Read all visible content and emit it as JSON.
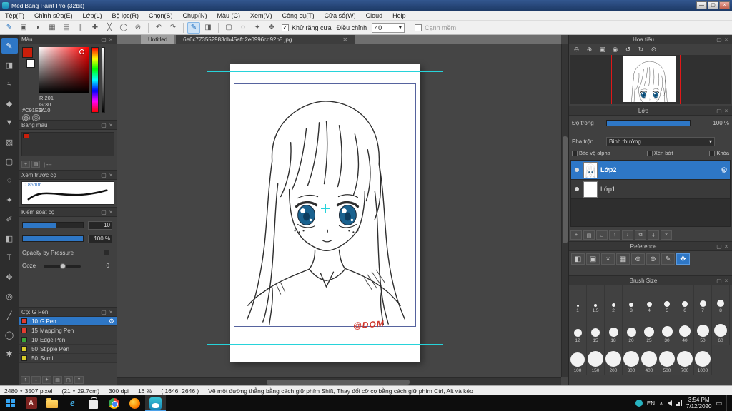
{
  "colors": {
    "accent": "#2e77c6",
    "guide_cyan": "#27d3da",
    "navigator_guide_red": "#e01818",
    "eye_blue": "#1a628f",
    "signature_red": "#cf3328",
    "foreground_swatch": "#c91e0a"
  },
  "titlebar": {
    "title": "MediBang Paint Pro (32bit)"
  },
  "window_buttons": [
    {
      "name": "minimize-button",
      "glyph": "—"
    },
    {
      "name": "maximize-button",
      "glyph": "▢"
    },
    {
      "name": "close-button",
      "glyph": "×"
    }
  ],
  "menubar": {
    "items": [
      "Tệp(F)",
      "Chỉnh sửa(E)",
      "Lớp(L)",
      "Bộ lọc(R)",
      "Chọn(S)",
      "Chụp(N)",
      "Màu (C)",
      "Xem(V)",
      "Công cụ(T)",
      "Cửa sổ(W)",
      "Cloud",
      "Help"
    ]
  },
  "toolbar": {
    "icons": [
      {
        "name": "pen-mode-icon",
        "glyph": "✎",
        "accent": true
      },
      {
        "name": "stamp-icon",
        "glyph": "▣"
      },
      {
        "name": "speech-bubble-icon",
        "glyph": "◗"
      },
      {
        "name": "grid-icon",
        "glyph": "▦"
      },
      {
        "name": "material-icon",
        "glyph": "▤"
      },
      {
        "name": "snap-parallel-icon",
        "glyph": "∥"
      },
      {
        "name": "snap-cross-icon",
        "glyph": "✚"
      },
      {
        "name": "snap-vanish-icon",
        "glyph": "╳"
      },
      {
        "name": "snap-circle-icon",
        "glyph": "◯"
      },
      {
        "name": "snap-off-icon",
        "glyph": "⊘"
      },
      {
        "sep": true
      },
      {
        "name": "undo-icon",
        "glyph": "↶"
      },
      {
        "name": "redo-icon",
        "glyph": "↷"
      },
      {
        "sep": true
      },
      {
        "name": "brush-tool-icon",
        "glyph": "✎",
        "selected": true
      },
      {
        "name": "eraser-tool-icon",
        "glyph": "◨"
      },
      {
        "sep": true
      },
      {
        "name": "select-rect-icon",
        "glyph": "▢"
      },
      {
        "name": "select-lasso-icon",
        "glyph": "◌"
      },
      {
        "name": "magic-wand-icon",
        "glyph": "✦"
      },
      {
        "name": "move-tool-icon",
        "glyph": "✥"
      }
    ],
    "antialias_label": "Khử răng cưa",
    "adjust_label": "Điều chỉnh",
    "adjust_value": "40",
    "soft_label": "Cạnh mềm"
  },
  "tabs": [
    {
      "label": "Untitled",
      "active": false
    },
    {
      "label": "6e6c773552983db45afd2e0996cd92b5.jpg",
      "active": true
    }
  ],
  "tools": [
    {
      "name": "brush-tool",
      "glyph": "✎",
      "active": true
    },
    {
      "name": "eraser-tool",
      "glyph": "◨"
    },
    {
      "name": "smudge-tool",
      "glyph": "≈"
    },
    {
      "name": "fill-tool",
      "glyph": "◆"
    },
    {
      "name": "bucket-tool",
      "glyph": "▼"
    },
    {
      "name": "gradient-tool",
      "glyph": "▨"
    },
    {
      "name": "select-tool",
      "glyph": "▢"
    },
    {
      "name": "lasso-tool",
      "glyph": "◌"
    },
    {
      "name": "magic-wand-tool",
      "glyph": "✦"
    },
    {
      "name": "select-pen-tool",
      "glyph": "✐"
    },
    {
      "name": "select-eraser-tool",
      "glyph": "◧"
    },
    {
      "name": "text-tool",
      "glyph": "T"
    },
    {
      "name": "operation-tool",
      "glyph": "✥"
    },
    {
      "name": "eyedropper-tool",
      "glyph": "◎"
    },
    {
      "name": "divide-tool",
      "glyph": "╱"
    },
    {
      "name": "zoom-tool",
      "glyph": "◯"
    },
    {
      "name": "hand-tool",
      "glyph": "✱"
    }
  ],
  "panel_buttons": {
    "dock": "▢",
    "close": "×"
  },
  "color_panel": {
    "title": "Màu",
    "r": "R:201",
    "g": "G:30",
    "b": "B:10",
    "hex": "#C91E0A",
    "icons": [
      {
        "name": "color-wheel-icon",
        "glyph": "◍"
      },
      {
        "name": "color-mode-icon",
        "glyph": "◎"
      }
    ]
  },
  "palette_panel": {
    "title": "Bảng màu",
    "name_label": "| ---",
    "icons": [
      {
        "name": "palette-add-icon",
        "glyph": "+"
      },
      {
        "name": "palette-menu-icon",
        "glyph": "▤"
      }
    ]
  },
  "preview_panel": {
    "title": "Xem trước cọ",
    "size_label": "0.85mm"
  },
  "control_panel": {
    "title": "Kiểm soát cọ",
    "size_value": "10",
    "opacity_value": "100 %",
    "pressure_label": "Opacity by Pressure",
    "ooze_label": "Ooze",
    "ooze_value": "0"
  },
  "brush_panel": {
    "title": "Cọ: G Pen",
    "brushes": [
      {
        "size": "10",
        "name": "G Pen",
        "chip": "#e23c30",
        "selected": true
      },
      {
        "size": "15",
        "name": "Mapping Pen",
        "chip": "#e23c30",
        "selected": false
      },
      {
        "size": "10",
        "name": "Edge Pen",
        "chip": "#3aa53a",
        "selected": false
      },
      {
        "size": "50",
        "name": "Stipple Pen",
        "chip": "#d9cc2a",
        "selected": false
      },
      {
        "size": "50",
        "name": "Sumi",
        "chip": "#d9cc2a",
        "selected": false
      }
    ],
    "foot_icons": [
      {
        "name": "brush-prev-icon",
        "glyph": "↑"
      },
      {
        "name": "brush-next-icon",
        "glyph": "↓"
      },
      {
        "name": "brush-add-icon",
        "glyph": "+"
      },
      {
        "name": "brush-menu-icon",
        "glyph": "▤"
      },
      {
        "name": "brush-duplicate-icon",
        "glyph": "▢"
      },
      {
        "name": "brush-delete-icon",
        "glyph": "×"
      }
    ]
  },
  "navigator": {
    "title": "Hoa tiêu",
    "icons": [
      {
        "name": "zoom-out-icon",
        "glyph": "⊖"
      },
      {
        "name": "zoom-in-icon",
        "glyph": "⊕"
      },
      {
        "name": "zoom-fit-icon",
        "glyph": "▣"
      },
      {
        "name": "zoom-actual-icon",
        "glyph": "◉"
      },
      {
        "name": "rotate-left-icon",
        "glyph": "↺"
      },
      {
        "name": "rotate-right-icon",
        "glyph": "↻"
      },
      {
        "name": "rotate-reset-icon",
        "glyph": "⊙"
      }
    ]
  },
  "layers_panel": {
    "title": "Lớp",
    "opacity_label": "Độ trong",
    "opacity_value": "100 %",
    "blend_label": "Pha trộn",
    "blend_value": "Bình thường",
    "checks": [
      "Bảo vệ alpha",
      "Xén bớt",
      "Khóa"
    ],
    "layers": [
      {
        "name": "Lớp2",
        "selected": true,
        "thumbnail": "girl"
      },
      {
        "name": "Lớp1",
        "selected": false,
        "thumbnail": "blank"
      }
    ],
    "foot_icons": [
      {
        "name": "layer-add-icon",
        "glyph": "+"
      },
      {
        "name": "layer-menu-icon",
        "glyph": "▤"
      },
      {
        "name": "layer-folder-icon",
        "glyph": "▱"
      },
      {
        "name": "layer-up-icon",
        "glyph": "↑"
      },
      {
        "name": "layer-down-icon",
        "glyph": "↓"
      },
      {
        "name": "layer-duplicate-icon",
        "glyph": "⧉"
      },
      {
        "name": "layer-merge-icon",
        "glyph": "⇓"
      },
      {
        "name": "layer-delete-icon",
        "glyph": "×"
      }
    ]
  },
  "reference_panel": {
    "title": "Reference",
    "icons": [
      {
        "name": "ref-pin-icon",
        "glyph": "◧"
      },
      {
        "name": "ref-image-icon",
        "glyph": "▣"
      },
      {
        "name": "ref-clear-icon",
        "glyph": "×"
      },
      {
        "name": "ref-grid-icon",
        "glyph": "▦"
      },
      {
        "name": "ref-zoom-in-icon",
        "glyph": "⊕"
      },
      {
        "name": "ref-zoom-out-icon",
        "glyph": "⊖"
      },
      {
        "name": "ref-eyedropper-icon",
        "glyph": "✎"
      },
      {
        "name": "ref-hand-icon",
        "glyph": "✥",
        "hl": true
      }
    ]
  },
  "brush_size_panel": {
    "title": "Brush Size",
    "rows": [
      [
        "1",
        "1.5",
        "2",
        "3",
        "4",
        "5",
        "6",
        "7",
        "8"
      ],
      [
        "12",
        "15",
        "18",
        "20",
        "25",
        "30",
        "40",
        "50",
        "60"
      ],
      [
        "100",
        "150",
        "200",
        "300",
        "400",
        "500",
        "700",
        "1000"
      ]
    ]
  },
  "canvas": {
    "signature": "@DOM"
  },
  "statusbar": {
    "dimensions": "2480 × 3507 pixel",
    "size_cm": "(21 × 29.7cm)",
    "dpi": "300 dpi",
    "zoom": "16 %",
    "coords": "( 1646, 2646 )",
    "hint": "Vẽ một đường thẳng bằng cách giữ phím Shift, Thay đổi cỡ cọ bằng cách giữ phím Ctrl, Alt và kéo"
  },
  "taskbar": {
    "apps": [
      {
        "name": "start-button",
        "icon": "windows-logo"
      },
      {
        "name": "taskbar-app-a",
        "icon": "letter-tile",
        "glyph": "A"
      },
      {
        "name": "taskbar-file-explorer",
        "icon": "folder"
      },
      {
        "name": "taskbar-internet-explorer",
        "icon": "letter-e",
        "glyph": "e"
      },
      {
        "name": "taskbar-store",
        "icon": "store"
      },
      {
        "name": "taskbar-chrome",
        "icon": "chrome"
      },
      {
        "name": "taskbar-firefox",
        "icon": "firefox"
      },
      {
        "name": "taskbar-medibang",
        "icon": "medibang",
        "active": true
      }
    ],
    "tray_lang": "EN",
    "time": "3:54 PM",
    "date": "7/12/2020"
  }
}
